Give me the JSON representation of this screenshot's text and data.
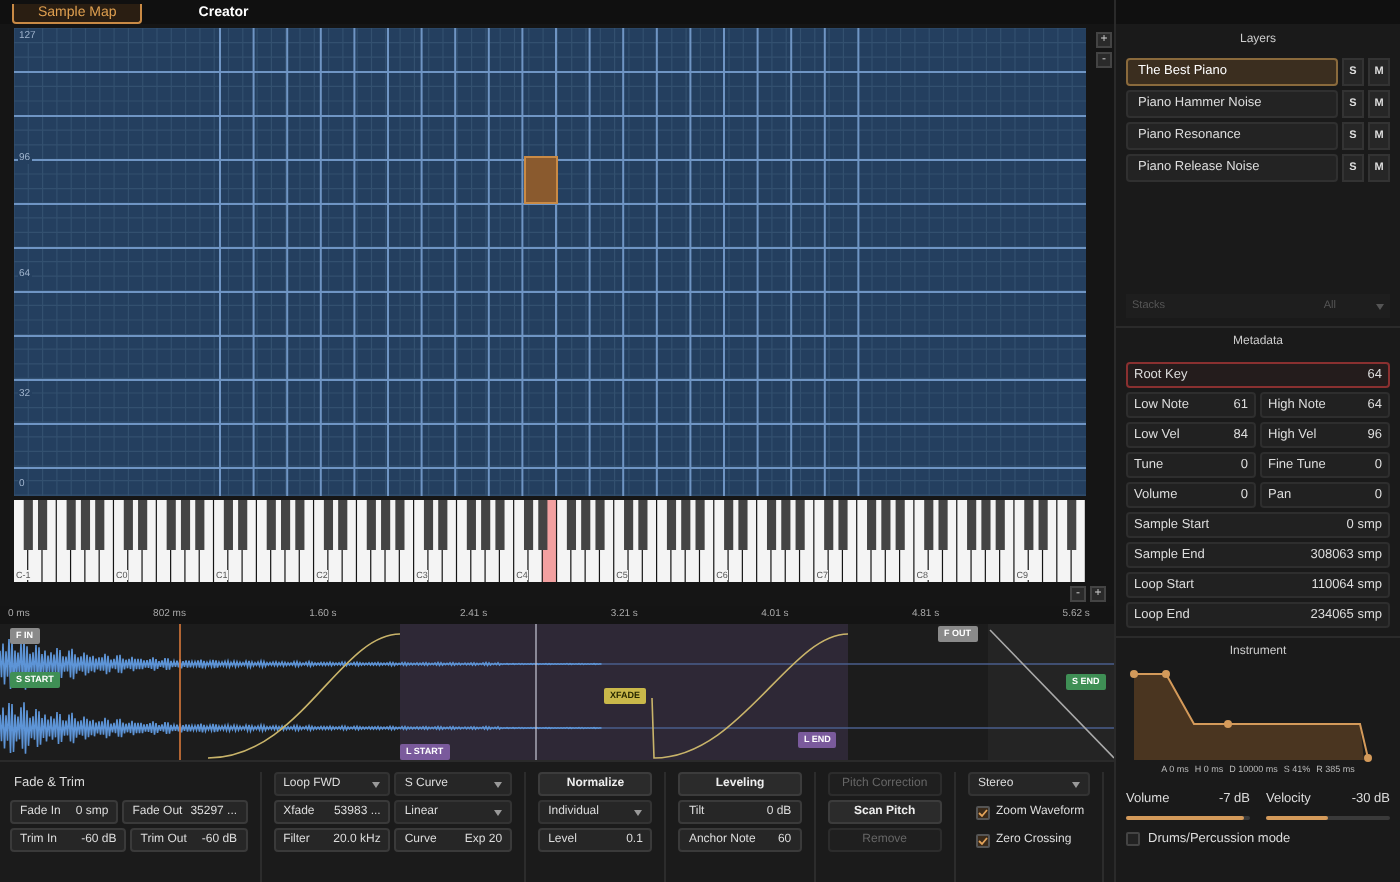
{
  "tabs": [
    {
      "label": "Sample Map",
      "selected": true
    },
    {
      "label": "Creator",
      "selected": false
    }
  ],
  "sample_map": {
    "axis_labels": [
      "127",
      "96",
      "64",
      "32",
      "0"
    ],
    "zoom_in": "+",
    "zoom_out": "-"
  },
  "keyboard": {
    "octave_labels": [
      "C-1",
      "C0",
      "C1",
      "C2",
      "C3",
      "C4",
      "C5",
      "C6",
      "C7",
      "C8",
      "C9"
    ],
    "zoom_out": "-",
    "zoom_in": "+"
  },
  "timeline": {
    "ticks": [
      "0 ms",
      "802 ms",
      "1.60 s",
      "2.41 s",
      "3.21 s",
      "4.01 s",
      "4.81 s",
      "5.62 s"
    ]
  },
  "markers": [
    {
      "label": "F IN",
      "kind": "fade"
    },
    {
      "label": "S START",
      "kind": "sample"
    },
    {
      "label": "XFADE",
      "kind": "xfade"
    },
    {
      "label": "L START",
      "kind": "loop"
    },
    {
      "label": "L END",
      "kind": "loop"
    },
    {
      "label": "F OUT",
      "kind": "fade"
    },
    {
      "label": "S END",
      "kind": "sample"
    }
  ],
  "controls": [
    {
      "rows": [
        [
          {
            "kind": "heading",
            "label": "Fade & Trim"
          }
        ],
        [
          {
            "kind": "field",
            "label": "Fade In",
            "value": "0 smp"
          },
          {
            "kind": "field",
            "label": "Fade Out",
            "value": "35297 ..."
          }
        ],
        [
          {
            "kind": "field",
            "label": "Trim In",
            "value": "-60 dB"
          },
          {
            "kind": "field",
            "label": "Trim Out",
            "value": "-60 dB"
          }
        ]
      ]
    },
    {
      "rows": [
        [
          {
            "kind": "dropdown",
            "label": "Loop FWD"
          },
          {
            "kind": "dropdown",
            "label": "S Curve"
          }
        ],
        [
          {
            "kind": "field",
            "label": "Xfade",
            "value": "53983 ..."
          },
          {
            "kind": "dropdown",
            "label": "Linear"
          }
        ],
        [
          {
            "kind": "field",
            "label": "Filter",
            "value": "20.0 kHz"
          },
          {
            "kind": "field",
            "label": "Curve",
            "value": "Exp 20"
          }
        ]
      ]
    },
    {
      "rows": [
        [
          {
            "kind": "button",
            "label": "Normalize",
            "disabled": false
          }
        ],
        [
          {
            "kind": "dropdown",
            "label": "Individual"
          }
        ],
        [
          {
            "kind": "field",
            "label": "Level",
            "value": "0.1"
          }
        ]
      ]
    },
    {
      "rows": [
        [
          {
            "kind": "button",
            "label": "Leveling",
            "disabled": false
          }
        ],
        [
          {
            "kind": "field",
            "label": "Tilt",
            "value": "0 dB"
          }
        ],
        [
          {
            "kind": "field",
            "label": "Anchor Note",
            "value": "60"
          }
        ]
      ]
    },
    {
      "rows": [
        [
          {
            "kind": "button",
            "label": "Pitch Correction",
            "disabled": true
          }
        ],
        [
          {
            "kind": "button",
            "label": "Scan Pitch",
            "disabled": false
          }
        ],
        [
          {
            "kind": "button",
            "label": "Remove",
            "disabled": true
          }
        ]
      ]
    },
    {
      "rows": [
        [
          {
            "kind": "dropdown",
            "label": "Stereo"
          }
        ],
        [
          {
            "kind": "checkbox",
            "label": "Zoom Waveform",
            "checked": true
          }
        ],
        [
          {
            "kind": "checkbox",
            "label": "Zero Crossing",
            "checked": true
          }
        ]
      ]
    }
  ],
  "layers": {
    "title": "Layers",
    "items": [
      {
        "name": "The Best Piano",
        "selected": true,
        "solo": "S",
        "mute": "M"
      },
      {
        "name": "Piano Hammer Noise",
        "selected": false,
        "solo": "S",
        "mute": "M"
      },
      {
        "name": "Piano Resonance",
        "selected": false,
        "solo": "S",
        "mute": "M"
      },
      {
        "name": "Piano Release Noise",
        "selected": false,
        "solo": "S",
        "mute": "M"
      }
    ],
    "stacks": {
      "label": "Stacks",
      "value": "All",
      "disabled": true
    }
  },
  "metadata": {
    "title": "Metadata",
    "rows": [
      [
        {
          "label": "Root Key",
          "value": "64",
          "selected": true
        }
      ],
      [
        {
          "label": "Low Note",
          "value": "61",
          "selected": false
        },
        {
          "label": "High Note",
          "value": "64",
          "selected": false
        }
      ],
      [
        {
          "label": "Low Vel",
          "value": "84",
          "selected": false
        },
        {
          "label": "High Vel",
          "value": "96",
          "selected": false
        }
      ],
      [
        {
          "label": "Tune",
          "value": "0",
          "selected": false
        },
        {
          "label": "Fine Tune",
          "value": "0",
          "selected": false
        }
      ],
      [
        {
          "label": "Volume",
          "value": "0",
          "selected": false
        },
        {
          "label": "Pan",
          "value": "0",
          "selected": false
        }
      ],
      [
        {
          "label": "Sample Start",
          "value": "0 smp",
          "selected": false
        }
      ],
      [
        {
          "label": "Sample End",
          "value": "308063 smp",
          "selected": false
        }
      ],
      [
        {
          "label": "Loop Start",
          "value": "110064 smp",
          "selected": false
        }
      ],
      [
        {
          "label": "Loop End",
          "value": "234065 smp",
          "selected": false
        }
      ]
    ]
  },
  "instrument": {
    "title": "Instrument",
    "envelope_labels": [
      "A 0 ms",
      "H 0 ms",
      "D 10000 ms",
      "S 41%",
      "R 385 ms"
    ],
    "sliders": [
      {
        "label": "Volume",
        "reading": "-7 dB",
        "level": 0.95
      },
      {
        "label": "Velocity",
        "reading": "-30 dB",
        "level": 0.5
      }
    ],
    "drums_mode": {
      "label": "Drums/Percussion mode",
      "checked": false
    }
  }
}
